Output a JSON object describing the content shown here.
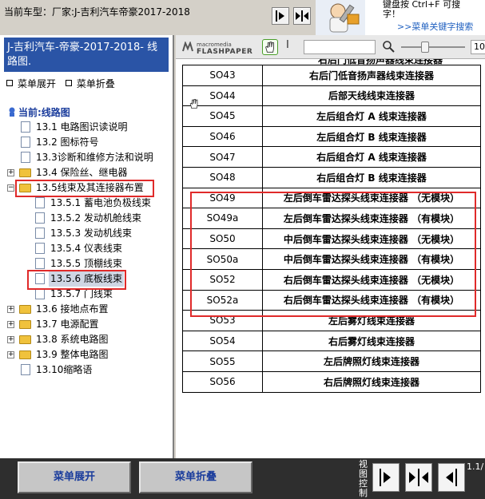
{
  "topbar": {
    "title": "当前车型：厂家:J-吉利汽车帝豪2017-2018",
    "tip_line1": "键盘按  Ctrl+F  可搜",
    "tip_line2": "字！",
    "tip_link": ">>菜单关键字搜索"
  },
  "left_panel": {
    "header": "J-吉利汽车-帝豪-2017-2018- 线路图.",
    "expand_label": "菜单展开",
    "collapse_label": "菜单折叠",
    "current_label": "当前:线路图",
    "tree": [
      {
        "label": "13.1 电路图识读说明"
      },
      {
        "label": "13.2 图标符号"
      },
      {
        "label": "13.3诊断和维修方法和说明"
      },
      {
        "label": "13.4 保险丝、继电器"
      },
      {
        "label": "13.5线束及其连接器布置"
      },
      {
        "label": "13.5.1 蓄电池负极线束"
      },
      {
        "label": "13.5.2 发动机舱线束"
      },
      {
        "label": "13.5.3 发动机线束"
      },
      {
        "label": "13.5.4 仪表线束"
      },
      {
        "label": "13.5.5 顶棚线束"
      },
      {
        "label": "13.5.6 底板线束"
      },
      {
        "label": "13.5.7 门线束"
      },
      {
        "label": "13.6 接地点布置"
      },
      {
        "label": "13.7 电源配置"
      },
      {
        "label": "13.8 系统电路图"
      },
      {
        "label": "13.9 整体电路图"
      },
      {
        "label": "13.10缩略语"
      }
    ]
  },
  "viewer": {
    "logo_top": "macromedia",
    "logo_main": "FLASHPAPER",
    "text_tool": "I",
    "zoom_value": "10",
    "partial_row_text": "右后门低音扬声器线束连接器",
    "rows": [
      {
        "code": "SO43",
        "desc": "右后门低音扬声器线束连接器"
      },
      {
        "code": "SO44",
        "desc": "后部天线线束连接器"
      },
      {
        "code": "SO45",
        "desc": "左后组合灯 A 线束连接器"
      },
      {
        "code": "SO46",
        "desc": "左后组合灯 B 线束连接器"
      },
      {
        "code": "SO47",
        "desc": "右后组合灯 A 线束连接器"
      },
      {
        "code": "SO48",
        "desc": "右后组合灯 B 线束连接器"
      },
      {
        "code": "SO49",
        "desc": "左后倒车雷达探头线束连接器 （无模块）"
      },
      {
        "code": "SO49a",
        "desc": "左后倒车雷达探头线束连接器 （有模块）"
      },
      {
        "code": "SO50",
        "desc": "中后倒车雷达探头线束连接器 （无模块）"
      },
      {
        "code": "SO50a",
        "desc": "中后倒车雷达探头线束连接器 （有模块）"
      },
      {
        "code": "SO52",
        "desc": "右后倒车雷达探头线束连接器 （无模块）"
      },
      {
        "code": "SO52a",
        "desc": "右后倒车雷达探头线束连接器 （有模块）"
      },
      {
        "code": "SO53",
        "desc": "左后雾灯线束连接器"
      },
      {
        "code": "SO54",
        "desc": "右后雾灯线束连接器"
      },
      {
        "code": "SO55",
        "desc": "左后牌照灯线束连接器"
      },
      {
        "code": "SO56",
        "desc": "右后牌照灯线束连接器"
      }
    ]
  },
  "bottombar": {
    "expand_button": "菜单展开",
    "collapse_button": "菜单折叠",
    "view_control_label": "视图控制",
    "page_num": "1.1/"
  },
  "colors": {
    "header_bg": "#2a54a6",
    "highlight": "#e02a2a",
    "bottom_bg": "#2e2e2e"
  }
}
